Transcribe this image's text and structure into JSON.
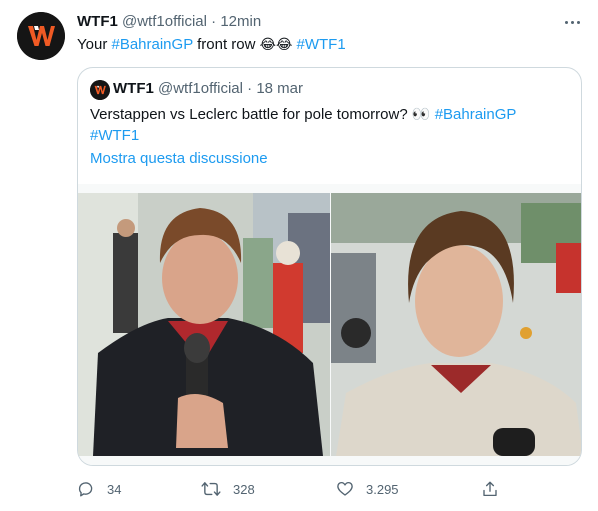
{
  "tweet": {
    "author_name": "WTF1",
    "author_handle": "@wtf1official",
    "separator": "·",
    "time": "12min",
    "text_prefix": "Your ",
    "hashtag_1": "#BahrainGP",
    "text_middle": " front row ",
    "emojis": "😂😂",
    "hashtag_2": "#WTF1"
  },
  "quoted_tweet": {
    "author_name": "WTF1",
    "author_handle": "@wtf1official",
    "separator": "·",
    "date": "18 mar",
    "text": "Verstappen vs Leclerc battle for pole tomorrow? 👀 ",
    "hashtag_1": "#BahrainGP",
    "hashtag_2": "#WTF1",
    "show_thread": "Mostra questa discussione"
  },
  "actions": {
    "replies": "34",
    "retweets": "328",
    "likes": "3.295"
  },
  "icons": {
    "avatar": "wtf1-logo-icon",
    "more": "more-options-icon",
    "reply": "reply-icon",
    "retweet": "retweet-icon",
    "like": "heart-icon",
    "share": "share-icon"
  },
  "colors": {
    "accent": "#1d9bf0",
    "text": "#0f1419",
    "muted": "#536471",
    "logo_orange": "#f05a24"
  }
}
